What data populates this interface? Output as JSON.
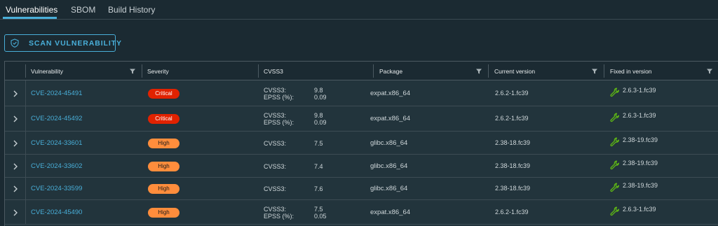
{
  "tabs": [
    {
      "label": "Vulnerabilities",
      "active": true
    },
    {
      "label": "SBOM",
      "active": false
    },
    {
      "label": "Build History",
      "active": false
    }
  ],
  "scan_button": {
    "label": "SCAN VULNERABILITY",
    "icon": "shield-icon"
  },
  "columns": [
    "Vulnerability",
    "Severity",
    "CVSS3",
    "Package",
    "Current version",
    "Fixed in version"
  ],
  "colors": {
    "accent": "#49afd9",
    "critical": "#e12200",
    "high": "#ff8d3c",
    "fix_icon": "#5eb715"
  },
  "rows": [
    {
      "id": "CVE-2024-45491",
      "severity": "Critical",
      "scores": [
        {
          "k": "CVSS3:",
          "v": "9.8"
        },
        {
          "k": "EPSS (%):",
          "v": "0.09"
        }
      ],
      "package": "expat.x86_64",
      "current": "2.6.2-1.fc39",
      "fixed": "2.6.3-1.fc39"
    },
    {
      "id": "CVE-2024-45492",
      "severity": "Critical",
      "scores": [
        {
          "k": "CVSS3:",
          "v": "9.8"
        },
        {
          "k": "EPSS (%):",
          "v": "0.09"
        }
      ],
      "package": "expat.x86_64",
      "current": "2.6.2-1.fc39",
      "fixed": "2.6.3-1.fc39"
    },
    {
      "id": "CVE-2024-33601",
      "severity": "High",
      "scores": [
        {
          "k": "CVSS3:",
          "v": "7.5"
        }
      ],
      "package": "glibc.x86_64",
      "current": "2.38-18.fc39",
      "fixed": "2.38-19.fc39"
    },
    {
      "id": "CVE-2024-33602",
      "severity": "High",
      "scores": [
        {
          "k": "CVSS3:",
          "v": "7.4"
        }
      ],
      "package": "glibc.x86_64",
      "current": "2.38-18.fc39",
      "fixed": "2.38-19.fc39"
    },
    {
      "id": "CVE-2024-33599",
      "severity": "High",
      "scores": [
        {
          "k": "CVSS3:",
          "v": "7.6"
        }
      ],
      "package": "glibc.x86_64",
      "current": "2.38-18.fc39",
      "fixed": "2.38-19.fc39"
    },
    {
      "id": "CVE-2024-45490",
      "severity": "High",
      "scores": [
        {
          "k": "CVSS3:",
          "v": "7.5"
        },
        {
          "k": "EPSS (%):",
          "v": "0.05"
        }
      ],
      "package": "expat.x86_64",
      "current": "2.6.2-1.fc39",
      "fixed": "2.6.3-1.fc39"
    }
  ]
}
